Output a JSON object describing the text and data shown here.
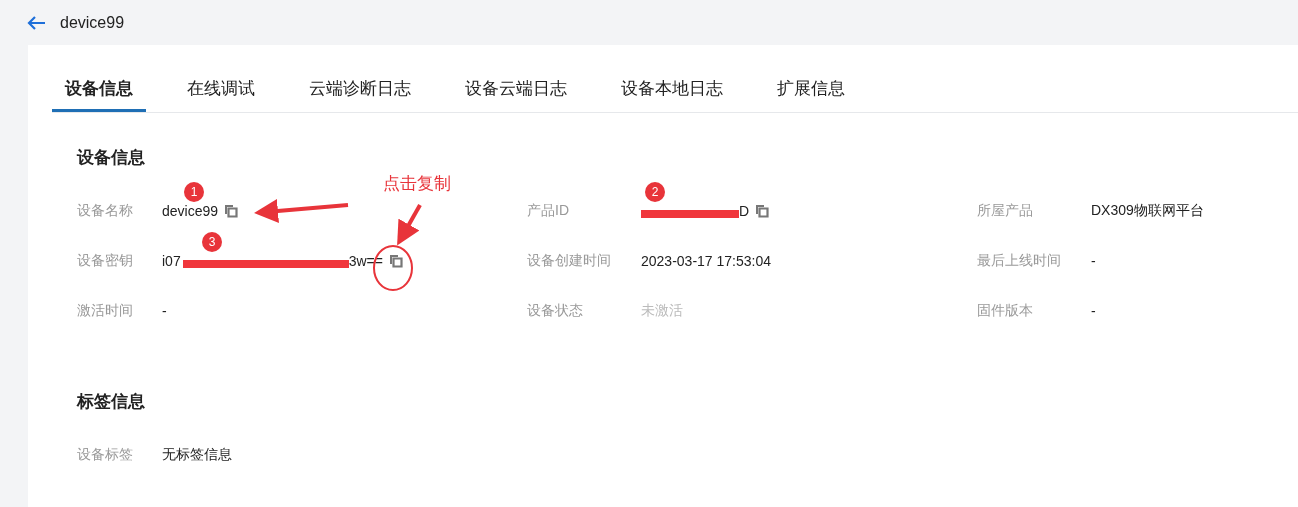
{
  "header": {
    "title": "device99"
  },
  "tabs": [
    {
      "label": "设备信息",
      "selected": true
    },
    {
      "label": "在线调试",
      "selected": false
    },
    {
      "label": "云端诊断日志",
      "selected": false
    },
    {
      "label": "设备云端日志",
      "selected": false
    },
    {
      "label": "设备本地日志",
      "selected": false
    },
    {
      "label": "扩展信息",
      "selected": false
    }
  ],
  "sections": [
    {
      "title": "设备信息",
      "fields": [
        {
          "label": "设备名称",
          "kind": "text",
          "value": "device99",
          "copyable": true,
          "badge": "1"
        },
        {
          "label": "产品ID",
          "kind": "redacted",
          "value_after": "D",
          "copyable": true,
          "badge": "2"
        },
        {
          "label": "所屋产品",
          "kind": "text",
          "value": "DX309物联网平台",
          "copyable": false
        },
        {
          "label": "设备密钥",
          "kind": "redacted",
          "value_before": "i07",
          "value_after": "3w==",
          "copyable": true,
          "badge": "3"
        },
        {
          "label": "设备创建时间",
          "kind": "text",
          "value": "2023-03-17 17:53:04",
          "copyable": false
        },
        {
          "label": "最后上线时间",
          "kind": "text",
          "value": "-",
          "copyable": false
        },
        {
          "label": "激活时间",
          "kind": "text",
          "value": "-",
          "copyable": false
        },
        {
          "label": "设备状态",
          "kind": "muted",
          "value": "未激活",
          "copyable": false
        },
        {
          "label": "固件版本",
          "kind": "text",
          "value": "-",
          "copyable": false
        }
      ]
    },
    {
      "title": "标签信息",
      "fields": [
        {
          "label": "设备标签",
          "kind": "text",
          "value": "无标签信息",
          "copyable": false
        }
      ]
    }
  ],
  "annotation": {
    "note": "点击复制"
  }
}
